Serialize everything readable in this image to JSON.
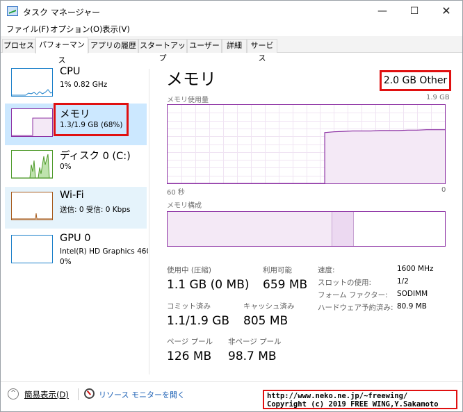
{
  "window": {
    "title": "タスク マネージャー",
    "controls": {
      "minimize": "—",
      "maximize": "☐",
      "close": "✕"
    }
  },
  "menu": [
    "ファイル(F)",
    "オプション(O)",
    "表示(V)"
  ],
  "tabs": [
    "プロセス",
    "パフォーマンス",
    "アプリの履歴",
    "スタートアップ",
    "ユーザー",
    "詳細",
    "サービス"
  ],
  "active_tab": "パフォーマンス",
  "sidebar": {
    "items": [
      {
        "title": "CPU",
        "subtitle": "1%  0.82 GHz",
        "graph_color": "#1a7fc9"
      },
      {
        "title": "メモリ",
        "subtitle": "1.3/1.9 GB (68%)",
        "graph_color": "#8b2fa3",
        "selected": true,
        "fill_fraction": 0.68
      },
      {
        "title": "ディスク 0 (C:)",
        "subtitle": "0%",
        "graph_color": "#4e9a2a"
      },
      {
        "title": "Wi-Fi",
        "subtitle": "送信: 0 受信: 0 Kbps",
        "graph_color": "#a65a1b"
      },
      {
        "title": "GPU 0",
        "subtitle": "Intel(R) HD Graphics 460",
        "subtitle2": "0%",
        "graph_color": "#1a7fc9"
      }
    ]
  },
  "main": {
    "title": "メモリ",
    "capacity": "2.0 GB Other",
    "usage_graph": {
      "label": "メモリ使用量",
      "max_label": "1.9 GB",
      "time_left": "60 秒",
      "time_right": "0"
    },
    "composition": {
      "label": "メモリ構成",
      "in_use_fraction": 0.59,
      "modified_fraction": 0.08
    },
    "stats": {
      "in_use_label": "使用中 (圧縮)",
      "in_use_value": "1.1 GB (0 MB)",
      "available_label": "利用可能",
      "available_value": "659 MB",
      "committed_label": "コミット済み",
      "committed_value": "1.1/1.9 GB",
      "cached_label": "キャッシュ済み",
      "cached_value": "805 MB",
      "paged_label": "ページ プール",
      "paged_value": "126 MB",
      "nonpaged_label": "非ページ プール",
      "nonpaged_value": "98.7 MB"
    },
    "details": [
      {
        "key": "速度:",
        "value": "1600 MHz"
      },
      {
        "key": "スロットの使用:",
        "value": "1/2"
      },
      {
        "key": "フォーム ファクター:",
        "value": "SODIMM"
      },
      {
        "key": "ハードウェア予約済み:",
        "value": "80.9 MB"
      }
    ]
  },
  "footer": {
    "fewer_details": "簡易表示(D)",
    "fewer_icon": "^",
    "resource_monitor": "リソース モニターを開く"
  },
  "copyright": {
    "line1": "http://www.neko.ne.jp/~freewing/",
    "line2": "Copyright (c) 2019 FREE WING,Y.Sakamoto"
  },
  "chart_data": {
    "type": "area",
    "title": "メモリ使用量",
    "xlabel": "",
    "ylabel": "",
    "x": [
      60,
      58,
      56,
      54,
      52,
      50,
      48,
      46,
      44,
      42,
      40,
      38,
      36,
      34,
      32,
      30,
      28,
      26,
      24,
      22,
      20,
      18,
      16,
      14,
      12,
      10,
      8,
      6,
      4,
      2,
      0
    ],
    "series": [
      {
        "values": [
          0,
          0,
          0,
          0,
          0,
          0,
          0,
          0,
          0,
          0,
          0,
          0,
          0,
          0,
          0,
          0,
          0,
          1.23,
          1.25,
          1.26,
          1.27,
          1.27,
          1.27,
          1.28,
          1.28,
          1.28,
          1.29,
          1.29,
          1.3,
          1.3,
          1.3
        ]
      }
    ],
    "xlim": [
      60,
      0
    ],
    "ylim": [
      0,
      1.9
    ],
    "grid": true
  }
}
